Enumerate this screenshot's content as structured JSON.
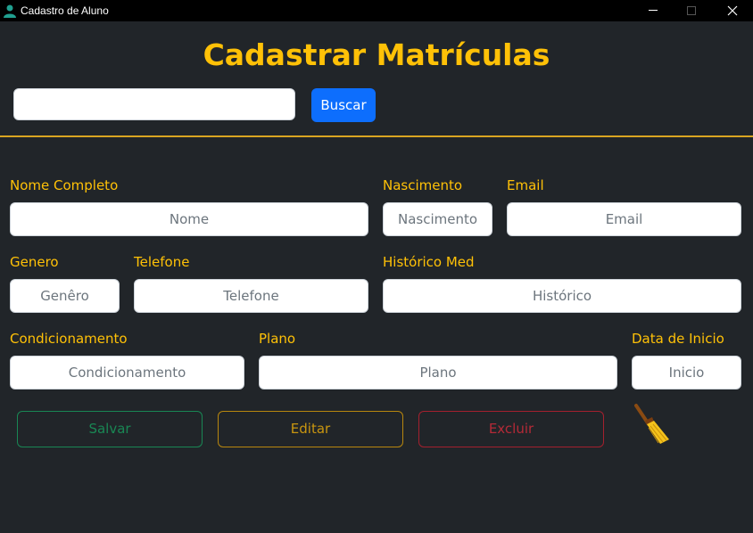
{
  "window": {
    "title": "Cadastro de Aluno",
    "controls": [
      "minimize-icon",
      "maximize-icon",
      "close-icon"
    ]
  },
  "header": {
    "title": "Cadastrar Matrículas"
  },
  "search": {
    "value": "",
    "button_label": "Buscar"
  },
  "form": {
    "nome": {
      "label": "Nome Completo",
      "placeholder": "Nome"
    },
    "nascimento": {
      "label": "Nascimento",
      "placeholder": "Nascimento"
    },
    "email": {
      "label": "Email",
      "placeholder": "Email"
    },
    "genero": {
      "label": "Genero",
      "placeholder": "Genêro"
    },
    "telefone": {
      "label": "Telefone",
      "placeholder": "Telefone"
    },
    "historico": {
      "label": "Histórico Med",
      "placeholder": "Histórico"
    },
    "condicionamento": {
      "label": "Condicionamento",
      "placeholder": "Condicionamento"
    },
    "plano": {
      "label": "Plano",
      "placeholder": "Plano"
    },
    "inicio": {
      "label": "Data de Inicio",
      "placeholder": "Inicio"
    }
  },
  "actions": {
    "save_label": "Salvar",
    "edit_label": "Editar",
    "delete_label": "Excluir",
    "clear_icon": "broom-icon"
  },
  "colors": {
    "background": "#212529",
    "accent": "#ffc107",
    "primary": "#0d6efd",
    "success": "#198754",
    "danger": "#dc3545"
  }
}
